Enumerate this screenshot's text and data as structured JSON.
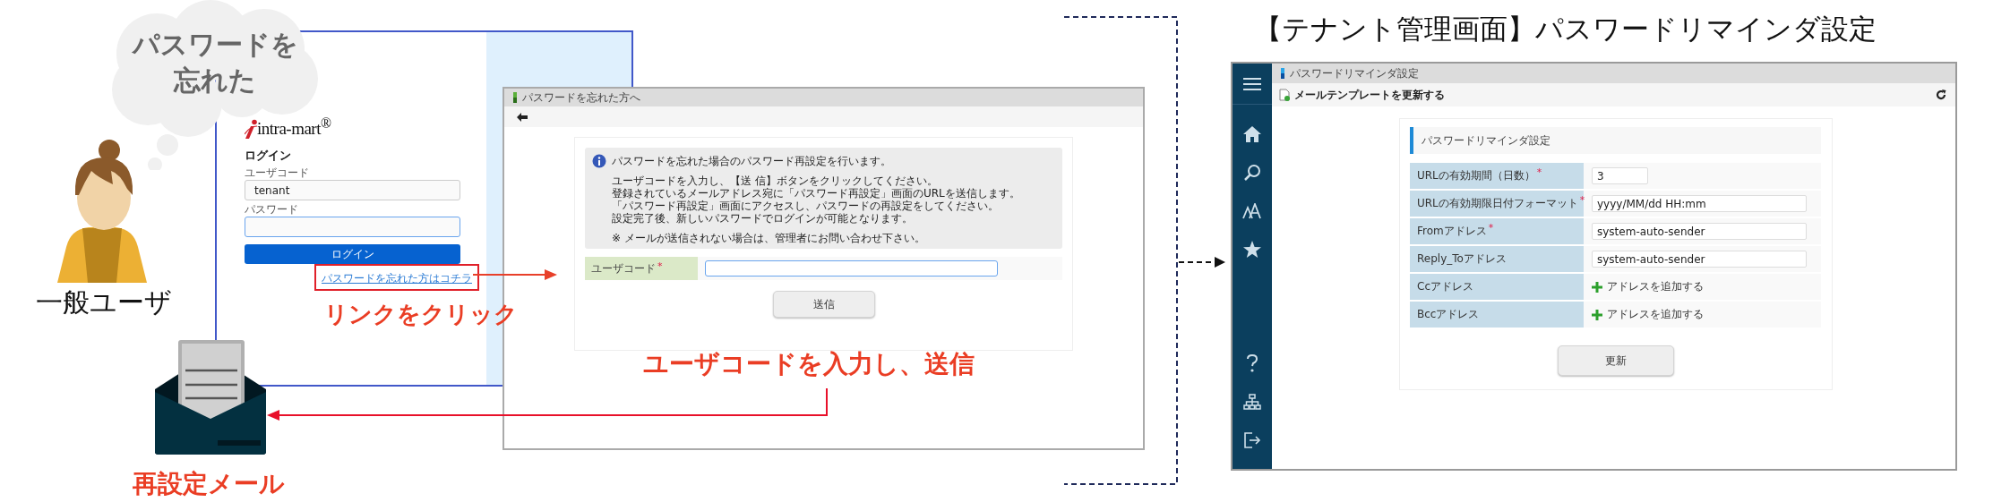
{
  "thought_bubble": {
    "lines": [
      "パスワードを",
      "忘れた"
    ]
  },
  "user": {
    "label": "一般ユーザ"
  },
  "login_screen": {
    "logo": "intra-mart$^{®}$",
    "title": "ログイン",
    "fields": [
      {
        "label": "ユーザコード",
        "value": "tenant",
        "focused": false
      },
      {
        "label": "パスワード",
        "focused": true
      }
    ],
    "button": "ログイン",
    "forgot_link": "パスワードを忘れた方はコチラ"
  },
  "callouts": {
    "click_link": "リンクをクリック",
    "submit": "ユーザコードを入力し、送信",
    "mail": "再設定メール"
  },
  "reset_screen": {
    "title": "パスワードを忘れた方へ",
    "info_title": "パスワードを忘れた場合のパスワード再設定を行います。",
    "info_lines": [
      "ユーザコードを入力し、【送 信】ボタンをクリックしてください。",
      "登録されているメールアドレス宛に「パスワード再設定」画面のURLを送信します。",
      "「パスワード再設定」画面にアクセスし、パスワードの再設定をしてください。",
      "設定完了後、新しいパスワードでログインが可能となります。"
    ],
    "note": "※ メールが送信されない場合は、管理者にお問い合わせ下さい。",
    "field": {
      "label": "ユーザコード",
      "required_mark": "*",
      "focused": true
    },
    "button": "送信"
  },
  "admin_title": "【テナント管理画面】パスワードリマインダ設定",
  "admin_screen": {
    "window_title": "パスワードリマインダ設定",
    "toolbar_action": "メールテンプレートを更新する",
    "panel_title": "パスワードリマインダ設定",
    "rows": [
      {
        "label": "URLの有効期間（日数）",
        "required_mark": "*",
        "kind": "number",
        "value": "3"
      },
      {
        "label": "URLの有効期限日付フォーマット",
        "required_mark": "*",
        "kind": "text",
        "value": "yyyy/MM/dd HH:mm"
      },
      {
        "label": "Fromアドレス",
        "required_mark": "*",
        "kind": "text",
        "value": "system-auto-sender"
      },
      {
        "label": "Reply_Toアドレス",
        "kind": "text",
        "value": "system-auto-sender"
      },
      {
        "label": "Ccアドレス",
        "kind": "add",
        "value": "アドレスを追加する"
      },
      {
        "label": "Bccアドレス",
        "kind": "add",
        "value": "アドレスを追加する"
      }
    ],
    "button": "更新"
  }
}
